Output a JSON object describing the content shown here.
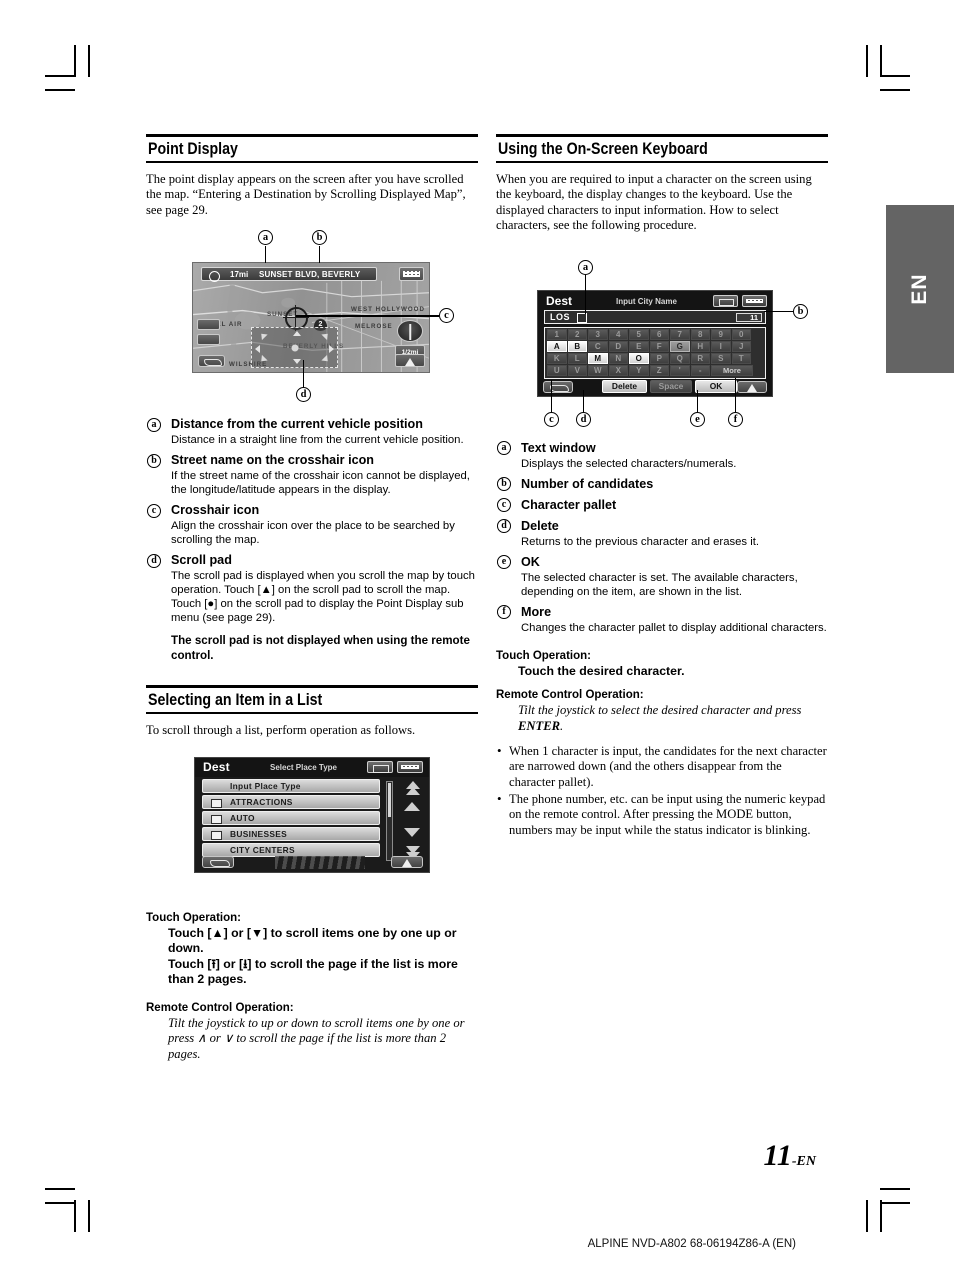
{
  "page": {
    "number": "11",
    "number_suffix": "-EN",
    "side_tab": "EN",
    "footer_code": "ALPINE NVD-A802 68-06194Z86-A (EN)"
  },
  "left_column": {
    "section1": {
      "heading": "Point Display",
      "intro": "The point display appears on the screen after you have scrolled the map. “Entering a Destination by Scrolling Displayed Map”, see page 29.",
      "figure": {
        "name": "point-display-map-screenshot",
        "callouts": [
          "a",
          "b",
          "c",
          "d"
        ],
        "top_bar": {
          "distance": "17mi",
          "street": "SUNSET BLVD, BEVERLY"
        },
        "map_labels": [
          "BEL AIR",
          "WEST HOLLYWOOD",
          "MELROSE",
          "WILSHIRE",
          "BEVERLY HILLS",
          "SUNSET"
        ],
        "scale_button": "1/2mi",
        "pin_number": "2"
      },
      "items": [
        {
          "mark": "a",
          "term": "Distance from the current vehicle position",
          "body": "Distance in a straight line from the current vehicle position."
        },
        {
          "mark": "b",
          "term": "Street name on the crosshair icon",
          "body": "If the street name of the crosshair icon cannot be displayed, the longitude/latitude appears in the display."
        },
        {
          "mark": "c",
          "term": "Crosshair icon",
          "body": "Align the crosshair icon over the place to be searched by scrolling the map."
        },
        {
          "mark": "d",
          "term": "Scroll pad",
          "body": "The scroll pad is displayed when you scroll the map by touch operation. Touch [▲] on the scroll pad to scroll the map.\nTouch [●] on the scroll pad to display the Point Display sub menu (see page 29)."
        }
      ],
      "note": "The scroll pad is not displayed when using the remote control."
    },
    "section2": {
      "heading": "Selecting an Item in a List",
      "intro": "To scroll through a list, perform operation as follows.",
      "figure": {
        "name": "select-place-type-screenshot",
        "title": "Dest",
        "subtitle": "Select Place Type",
        "rows": [
          {
            "label": "Input Place Type",
            "has_icon": false
          },
          {
            "label": "ATTRACTIONS",
            "has_icon": true
          },
          {
            "label": "AUTO",
            "has_icon": true
          },
          {
            "label": "BUSINESSES",
            "has_icon": true
          },
          {
            "label": "CITY CENTERS",
            "has_icon": false
          }
        ]
      },
      "touch_label": "Touch Operation:",
      "touch_text_1": "Touch [▲] or [▼] to scroll items one by one up or down.",
      "touch_text_2": "Touch [⭱] or [⭳] to scroll the page if the list is more than 2 pages.",
      "remote_label": "Remote Control Operation:",
      "remote_text": "Tilt the joystick to up or down to scroll items one by one or press ∧ or ∨ to scroll the page if the list is more than 2 pages."
    }
  },
  "right_column": {
    "section1": {
      "heading": "Using the On-Screen Keyboard",
      "intro": "When you are required to input a character on the screen using the keyboard, the display changes to the keyboard. Use the displayed characters to input information. How to select characters, see the following procedure.",
      "figure": {
        "name": "on-screen-keyboard-screenshot",
        "title": "Dest",
        "subtitle": "Input City Name",
        "text_value": "LOS",
        "candidate_count": "11",
        "rows": [
          [
            "1",
            "2",
            "3",
            "4",
            "5",
            "6",
            "7",
            "8",
            "9",
            "0"
          ],
          [
            "A",
            "B",
            "C",
            "D",
            "E",
            "F",
            "G",
            "H",
            "I",
            "J"
          ],
          [
            "K",
            "L",
            "M",
            "N",
            "O",
            "P",
            "Q",
            "R",
            "S",
            "T"
          ],
          [
            "U",
            "V",
            "W",
            "X",
            "Y",
            "Z",
            "'",
            "-",
            "More"
          ]
        ],
        "highlighted_keys": [
          "A",
          "B",
          "M",
          "O"
        ],
        "dim_highlight_keys": [
          "G"
        ],
        "bottom_buttons": [
          "Delete",
          "Space",
          "OK"
        ],
        "callouts": [
          "a",
          "b",
          "c",
          "d",
          "e",
          "f"
        ]
      },
      "items": [
        {
          "mark": "a",
          "term": "Text window",
          "body": "Displays the selected characters/numerals."
        },
        {
          "mark": "b",
          "term": "Number of candidates",
          "body": ""
        },
        {
          "mark": "c",
          "term": "Character pallet",
          "body": ""
        },
        {
          "mark": "d",
          "term": "Delete",
          "body": "Returns to the previous character and erases it."
        },
        {
          "mark": "e",
          "term": "OK",
          "body": "The selected character is set. The available characters, depending on the item, are shown in the list."
        },
        {
          "mark": "f",
          "term": "More",
          "body": "Changes the character pallet to display additional characters."
        }
      ],
      "touch_label": "Touch Operation:",
      "touch_text": "Touch the desired character.",
      "remote_label": "Remote Control Operation:",
      "remote_text_pre": "Tilt the joystick to select the desired character and press ",
      "remote_text_bold": "ENTER",
      "remote_text_post": ".",
      "bullets": [
        "When 1 character is input, the candidates for the next character are narrowed down (and the others disappear from the character pallet).",
        "The phone number, etc. can be input using the numeric keypad on the remote control. After pressing the MODE button, numbers may be input while the status indicator is blinking."
      ]
    }
  }
}
